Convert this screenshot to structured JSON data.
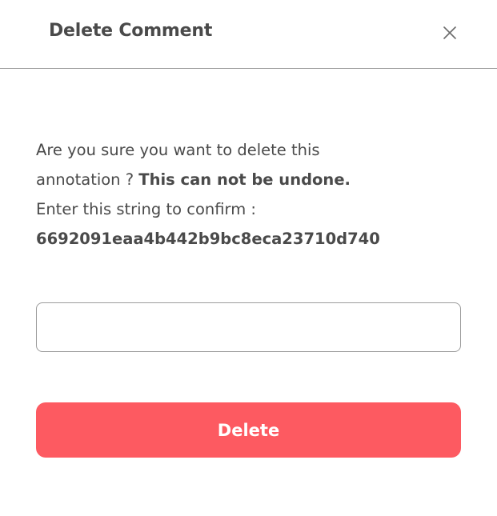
{
  "dialog": {
    "title": "Delete Comment",
    "close_icon": "close-icon",
    "message": {
      "line1": "Are you sure you want to delete this",
      "line2_prefix": "annotation ? ",
      "line2_strong": "This can not be undone.",
      "line3": "Enter this string to confirm :",
      "confirm_string": "6692091eaa4b442b9bc8eca23710d740"
    },
    "input": {
      "value": "",
      "placeholder": ""
    },
    "delete_label": "Delete"
  },
  "colors": {
    "accent": "#fd5a61",
    "text": "#4a4a4a",
    "divider": "#9a9a9a"
  }
}
